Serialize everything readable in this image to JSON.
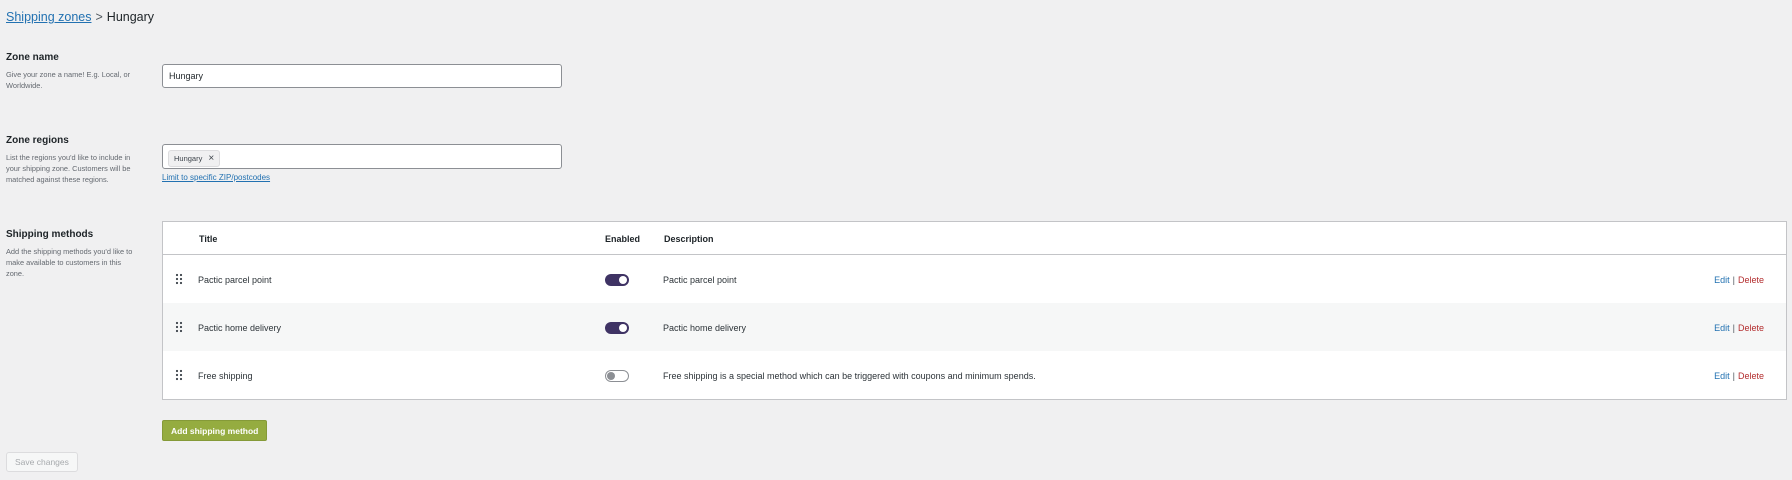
{
  "breadcrumb": {
    "parent": "Shipping zones",
    "separator": ">",
    "current": "Hungary"
  },
  "zone_name": {
    "label": "Zone name",
    "description": "Give your zone a name! E.g. Local, or Worldwide.",
    "value": "Hungary"
  },
  "zone_regions": {
    "label": "Zone regions",
    "description": "List the regions you'd like to include in your shipping zone. Customers will be matched against these regions.",
    "chips": [
      "Hungary"
    ],
    "remove_symbol": "×",
    "limit_link": "Limit to specific ZIP/postcodes"
  },
  "shipping_methods": {
    "label": "Shipping methods",
    "description": "Add the shipping methods you'd like to make available to customers in this zone.",
    "columns": {
      "title": "Title",
      "enabled": "Enabled",
      "description": "Description"
    },
    "rows": [
      {
        "title": "Pactic parcel point",
        "enabled": true,
        "description": "Pactic parcel point",
        "edit": "Edit",
        "separator": "|",
        "delete": "Delete"
      },
      {
        "title": "Pactic home delivery",
        "enabled": true,
        "description": "Pactic home delivery",
        "edit": "Edit",
        "separator": "|",
        "delete": "Delete"
      },
      {
        "title": "Free shipping",
        "enabled": false,
        "description": "Free shipping is a special method which can be triggered with coupons and minimum spends.",
        "edit": "Edit",
        "separator": "|",
        "delete": "Delete"
      }
    ],
    "add_button": "Add shipping method"
  },
  "save_button": "Save changes",
  "colors": {
    "link": "#2271b1",
    "delete": "#b32d2e",
    "toggle_on": "#3f3364",
    "add_button": "#95ac40"
  },
  "icons": {
    "drag": "drag-handle-icon",
    "remove": "close-icon"
  }
}
